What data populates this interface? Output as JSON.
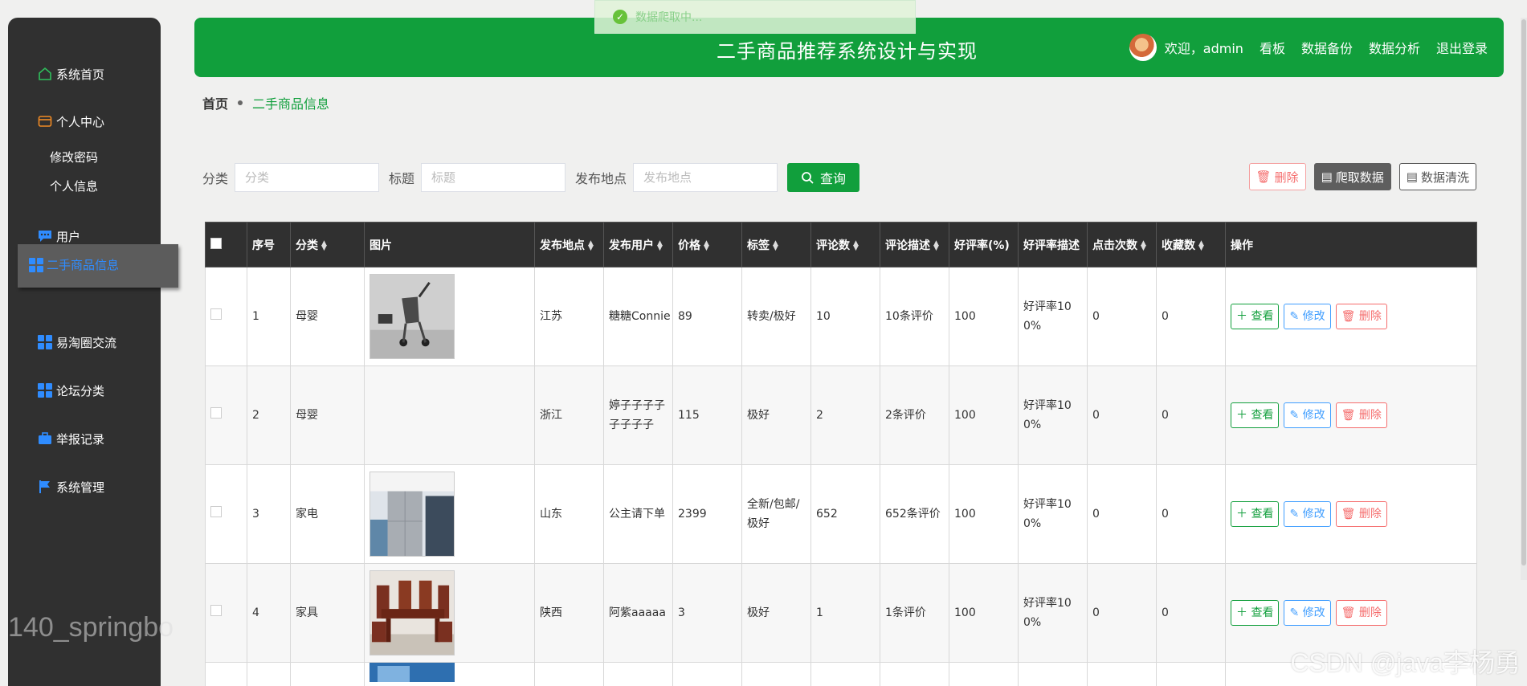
{
  "toast": {
    "text": "数据爬取中..."
  },
  "header": {
    "title": "二手商品推荐系统设计与实现",
    "welcome": "欢迎，admin",
    "links": [
      "看板",
      "数据备份",
      "数据分析",
      "退出登录"
    ]
  },
  "sidebar": {
    "items": [
      {
        "label": "系统首页",
        "icon": "home-icon"
      },
      {
        "label": "个人中心",
        "icon": "wallet-icon"
      },
      {
        "label": "用户",
        "icon": "chat-icon"
      },
      {
        "label": "二手商品信息",
        "icon": "grid-icon"
      },
      {
        "label": "易淘圈交流",
        "icon": "grid-icon"
      },
      {
        "label": "论坛分类",
        "icon": "grid-icon"
      },
      {
        "label": "举报记录",
        "icon": "briefcase-icon"
      },
      {
        "label": "系统管理",
        "icon": "flag-icon"
      }
    ],
    "sub_items": [
      "修改密码",
      "个人信息"
    ],
    "watermark": "140_springbo"
  },
  "breadcrumb": {
    "home": "首页",
    "current": "二手商品信息"
  },
  "search": {
    "category_label": "分类",
    "category_placeholder": "分类",
    "title_label": "标题",
    "title_placeholder": "标题",
    "location_label": "发布地点",
    "location_placeholder": "发布地点",
    "query_button": "查询"
  },
  "actions": {
    "delete": "删除",
    "crawl": "爬取数据",
    "clean": "数据清洗"
  },
  "table": {
    "headers": [
      "序号",
      "分类",
      "图片",
      "发布地点",
      "发布用户",
      "价格",
      "标签",
      "评论数",
      "评论描述",
      "好评率(%)",
      "好评率描述",
      "点击次数",
      "收藏数",
      "操作"
    ],
    "rows": [
      {
        "no": "1",
        "category": "母婴",
        "location": "江苏",
        "user": "糖糖Connie",
        "price": "89",
        "tags": "转卖/极好",
        "comments": "10",
        "comment_desc": "10条评价",
        "rate": "100",
        "rate_desc": "好评率100%",
        "clicks": "0",
        "favs": "0"
      },
      {
        "no": "2",
        "category": "母婴",
        "location": "浙江",
        "user": "婷子子子子子子子子",
        "price": "115",
        "tags": "极好",
        "comments": "2",
        "comment_desc": "2条评价",
        "rate": "100",
        "rate_desc": "好评率100%",
        "clicks": "0",
        "favs": "0"
      },
      {
        "no": "3",
        "category": "家电",
        "location": "山东",
        "user": "公主请下单",
        "price": "2399",
        "tags": "全新/包邮/极好",
        "comments": "652",
        "comment_desc": "652条评价",
        "rate": "100",
        "rate_desc": "好评率100%",
        "clicks": "0",
        "favs": "0"
      },
      {
        "no": "4",
        "category": "家具",
        "location": "陕西",
        "user": "阿紫aaaaa",
        "price": "3",
        "tags": "极好",
        "comments": "1",
        "comment_desc": "1条评价",
        "rate": "100",
        "rate_desc": "好评率100%",
        "clicks": "0",
        "favs": "0"
      }
    ],
    "op_view": "查看",
    "op_edit": "修改",
    "op_delete": "删除"
  },
  "watermark_right": "CSDN @java李杨勇",
  "colors": {
    "primary": "#119f3c",
    "sidebar": "#303030",
    "active_link": "#2f8cff",
    "danger": "#f56c6c",
    "info": "#409eff"
  }
}
